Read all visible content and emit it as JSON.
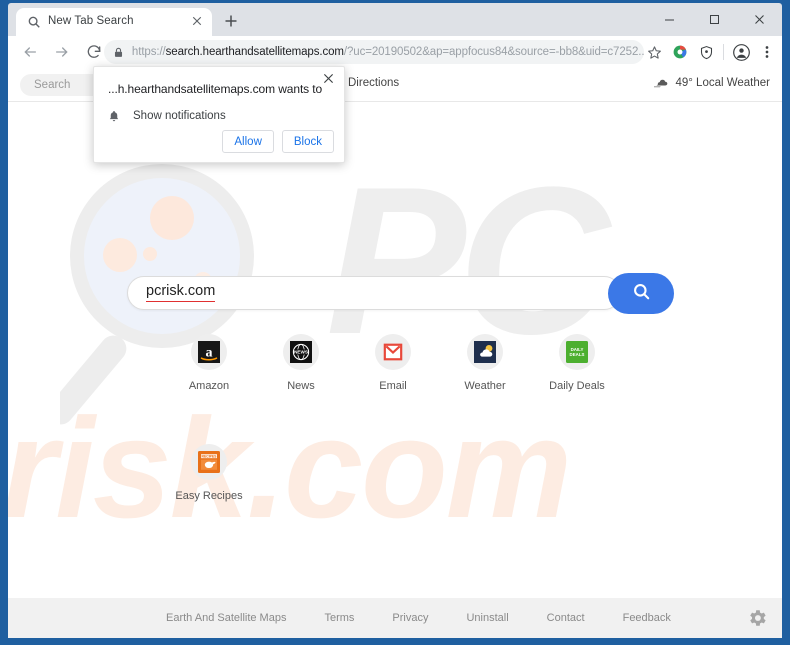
{
  "browser": {
    "tab": {
      "title": "New Tab Search",
      "favicon_icon": "search-icon",
      "close_icon": "close-icon"
    },
    "new_tab_label": "+",
    "window_controls": {
      "minimize": "minimize-icon",
      "maximize": "maximize-icon",
      "close": "close-icon"
    },
    "nav": {
      "back_icon": "back-arrow-icon",
      "forward_icon": "forward-arrow-icon",
      "reload_icon": "reload-icon"
    },
    "omnibox": {
      "lock_icon": "lock-icon",
      "url_scheme": "https://",
      "url_host": "search.hearthandsatellitemaps.com",
      "url_path": "/?uc=20190502&ap=appfocus84&source=-bb8&uid=c7252...",
      "full_url": "https://search.hearthandsatellitemaps.com/?uc=20190502&ap=appfocus84&source=-bb8&uid=c7252..."
    },
    "toolbar_icons": [
      "bookmark-star-icon",
      "extension-colorful-icon",
      "shield-extension-icon",
      "profile-avatar-icon",
      "three-dot-menu-icon"
    ]
  },
  "notification_popup": {
    "title": "...h.hearthandsatellitemaps.com wants to",
    "permission_icon": "bell-icon",
    "permission_label": "Show notifications",
    "allow_label": "Allow",
    "block_label": "Block",
    "close_icon": "close-icon"
  },
  "page": {
    "header": {
      "search_placeholder": "Search",
      "directions_label": "Directions",
      "weather_icon": "weather-icon",
      "weather_label": "49° Local Weather"
    },
    "search": {
      "value": "pcrisk.com",
      "button_icon": "search-icon"
    },
    "shortcuts_row1": [
      {
        "label": "Amazon",
        "icon": "amazon-icon",
        "bg": "#1b1b1b",
        "accent": "#ff9900"
      },
      {
        "label": "News",
        "icon": "news-icon",
        "bg": "#111111",
        "accent": "#ffffff"
      },
      {
        "label": "Email",
        "icon": "email-icon",
        "bg": "#ffffff",
        "accent": "#e8483a"
      },
      {
        "label": "Weather",
        "icon": "weather-icon",
        "bg": "#1f2f4d",
        "accent": "#f5c542"
      },
      {
        "label": "Daily Deals",
        "icon": "daily-deals-icon",
        "bg": "#4caf2f",
        "accent": "#ffffff"
      }
    ],
    "shortcuts_row2": [
      {
        "label": "Easy Recipes",
        "icon": "easy-recipes-icon",
        "bg": "#e8711a",
        "accent": "#ffffff"
      }
    ],
    "footer": {
      "links": [
        "Earth And Satellite Maps",
        "Terms",
        "Privacy",
        "Uninstall",
        "Contact",
        "Feedback"
      ],
      "settings_icon": "gear-icon"
    },
    "watermarks": {
      "primary": "PC",
      "secondary": "risk.com"
    }
  },
  "colors": {
    "window_frame": "#1f5fa0",
    "tabstrip": "#dee1e6",
    "accent_blue": "#3b78e7",
    "link_blue": "#1a73e8",
    "footer_bg": "#f1f1f1",
    "watermark_grey": "#eeeeee",
    "watermark_peach": "#fdece2"
  }
}
